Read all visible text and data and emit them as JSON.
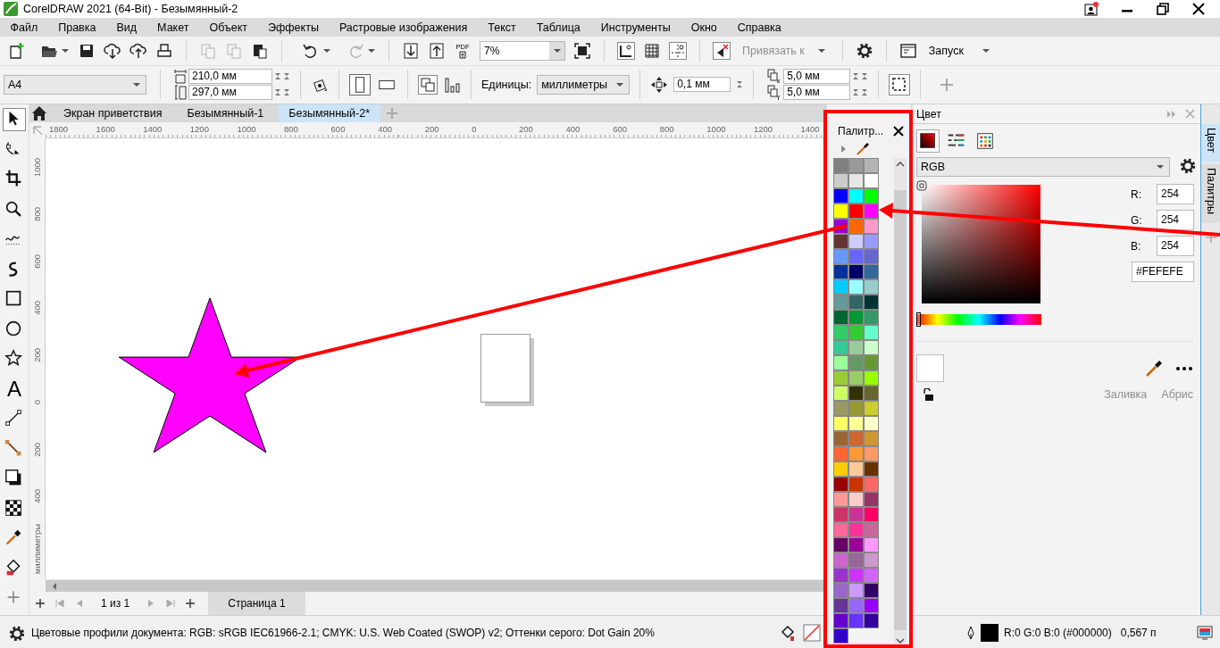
{
  "window": {
    "title": "CorelDRAW 2021 (64-Bit) - Безымянный-2"
  },
  "menu": [
    "Файл",
    "Правка",
    "Вид",
    "Макет",
    "Объект",
    "Эффекты",
    "Растровые изображения",
    "Текст",
    "Таблица",
    "Инструменты",
    "Окно",
    "Справка"
  ],
  "toolbar": {
    "buttons": [
      {
        "disabled": false
      },
      {
        "disabled": false
      },
      {
        "disabled": false
      },
      {
        "disabled": false
      },
      {
        "disabled": false
      },
      {
        "disabled": false
      },
      {
        "disabled": true
      },
      {
        "disabled": true
      },
      {
        "disabled": false
      },
      {
        "disabled": false
      },
      {
        "disabled": true
      },
      {
        "disabled": false
      },
      {
        "disabled": false
      },
      {
        "disabled": false
      },
      {
        "disabled": false
      },
      {
        "disabled": false
      },
      {
        "disabled": false
      },
      {
        "disabled": false
      },
      {
        "disabled": false
      },
      {
        "disabled": false
      },
      {
        "disabled": false
      }
    ],
    "pdf_label": "PDF",
    "zoom": "7%",
    "snap": {
      "label": "Привязать к",
      "disabled": true
    },
    "launch": "Запуск"
  },
  "property_bar": {
    "page_size": "A4",
    "width": "210,0 мм",
    "height": "297,0 мм",
    "orientation": [
      {
        "selected": true
      },
      {
        "selected": false
      }
    ],
    "units_label": "Единицы:",
    "units": "миллиметры",
    "nudge": "0,1 мм",
    "duplicate_x": "5,0 мм",
    "duplicate_y": "5,0 мм"
  },
  "toolbox": {
    "tools": [
      {
        "selected": true
      },
      {
        "selected": false
      },
      {
        "selected": false
      },
      {
        "selected": false
      },
      {
        "selected": false
      },
      {
        "selected": false
      },
      {
        "selected": false
      },
      {
        "selected": false
      },
      {
        "selected": false
      },
      {
        "selected": false,
        "glyph": "A"
      },
      {
        "selected": false
      },
      {
        "selected": false
      },
      {
        "selected": false
      },
      {
        "selected": false
      },
      {
        "selected": false
      },
      {
        "selected": false
      },
      {
        "selected": false
      }
    ]
  },
  "document_tabs": [
    {
      "label": "Экран приветствия",
      "selected": false
    },
    {
      "label": "Безымянный-1",
      "selected": false
    },
    {
      "label": "Безымянный-2*",
      "selected": true
    }
  ],
  "rulers": {
    "horizontal": [
      "1800",
      "1600",
      "1400",
      "1200",
      "1000",
      "800",
      "600",
      "400",
      "200",
      "0",
      "200",
      "400",
      "600",
      "800",
      "1000",
      "1200",
      "1400"
    ],
    "vertical": [
      "1000",
      "800",
      "600",
      "400",
      "200",
      "0",
      "200",
      "400"
    ],
    "unit": "миллиметры"
  },
  "page_nav": {
    "count": "1 из 1",
    "page_tab": "Страница 1"
  },
  "palette": {
    "title": "Палитр...",
    "swatches": [
      {
        "color": "#808080"
      },
      {
        "color": "#999999"
      },
      {
        "color": "#b3b3b3"
      },
      {
        "color": "#cccccc"
      },
      {
        "color": "#e6e6e6"
      },
      {
        "color": "#ffffff"
      },
      {
        "color": "#0000ff"
      },
      {
        "color": "#00ffff"
      },
      {
        "color": "#00ff00"
      },
      {
        "color": "#ffff00"
      },
      {
        "color": "#ff0000"
      },
      {
        "color": "#ff00ff"
      },
      {
        "color": "#9900cc"
      },
      {
        "color": "#ff6600"
      },
      {
        "color": "#ff99cc"
      },
      {
        "color": "#663333"
      },
      {
        "color": "#ccccff"
      },
      {
        "color": "#9999ff"
      },
      {
        "color": "#6699ff"
      },
      {
        "color": "#6666ff"
      },
      {
        "color": "#6666cc"
      },
      {
        "color": "#003399"
      },
      {
        "color": "#000066"
      },
      {
        "color": "#336699"
      },
      {
        "color": "#00ccff"
      },
      {
        "color": "#99ffff"
      },
      {
        "color": "#99cccc"
      },
      {
        "color": "#669999"
      },
      {
        "color": "#336666"
      },
      {
        "color": "#003333"
      },
      {
        "color": "#006633"
      },
      {
        "color": "#009933"
      },
      {
        "color": "#339966"
      },
      {
        "color": "#33cc66"
      },
      {
        "color": "#33cc33"
      },
      {
        "color": "#66ffcc"
      },
      {
        "color": "#33cc99"
      },
      {
        "color": "#99cc99"
      },
      {
        "color": "#ccffcc"
      },
      {
        "color": "#99ff99"
      },
      {
        "color": "#669966"
      },
      {
        "color": "#669933"
      },
      {
        "color": "#99cc33"
      },
      {
        "color": "#99cc66"
      },
      {
        "color": "#99ff00"
      },
      {
        "color": "#ccff66"
      },
      {
        "color": "#333300"
      },
      {
        "color": "#666633"
      },
      {
        "color": "#999966"
      },
      {
        "color": "#999933"
      },
      {
        "color": "#cccc33"
      },
      {
        "color": "#ffff66"
      },
      {
        "color": "#ffff99"
      },
      {
        "color": "#ffffcc"
      },
      {
        "color": "#996633"
      },
      {
        "color": "#cc6633"
      },
      {
        "color": "#cc9933"
      },
      {
        "color": "#ff6633"
      },
      {
        "color": "#ff9933"
      },
      {
        "color": "#ff9966"
      },
      {
        "color": "#ffcc00"
      },
      {
        "color": "#ffcc99"
      },
      {
        "color": "#663300"
      },
      {
        "color": "#990000"
      },
      {
        "color": "#cc3300"
      },
      {
        "color": "#ff6666"
      },
      {
        "color": "#ff9999"
      },
      {
        "color": "#ffcccc"
      },
      {
        "color": "#993366"
      },
      {
        "color": "#cc3366"
      },
      {
        "color": "#cc3399"
      },
      {
        "color": "#ff0066"
      },
      {
        "color": "#ff6699"
      },
      {
        "color": "#ff3399"
      },
      {
        "color": "#cc6699"
      },
      {
        "color": "#660066"
      },
      {
        "color": "#990099"
      },
      {
        "color": "#ff99ff"
      },
      {
        "color": "#cc66cc"
      },
      {
        "color": "#996699"
      },
      {
        "color": "#cc99cc"
      },
      {
        "color": "#9933cc"
      },
      {
        "color": "#cc33ff"
      },
      {
        "color": "#cc66ff"
      },
      {
        "color": "#9966cc"
      },
      {
        "color": "#cc99ff"
      },
      {
        "color": "#330066"
      },
      {
        "color": "#663399"
      },
      {
        "color": "#9966ff"
      },
      {
        "color": "#9900ff"
      },
      {
        "color": "#6600cc"
      },
      {
        "color": "#6633ff"
      },
      {
        "color": "#330099"
      },
      {
        "color": "#3300cc"
      }
    ]
  },
  "color_docker": {
    "title": "Цвет",
    "view_modes": [
      {
        "selected": true
      },
      {
        "selected": false
      },
      {
        "selected": false
      }
    ],
    "model": "RGB",
    "r_label": "R:",
    "r": "254",
    "g_label": "G:",
    "g": "254",
    "b_label": "B:",
    "b": "254",
    "hex": "#FEFEFE",
    "hue": {
      "level": 0
    },
    "fill": {
      "label": "Заливка",
      "disabled": true
    },
    "outline": {
      "label": "Абрис",
      "disabled": true
    }
  },
  "docker_tabs": [
    {
      "label": "Цвет",
      "selected": true
    },
    {
      "label": "Палитры",
      "selected": false
    }
  ],
  "status_bar": {
    "profiles": "Цветовые профили документа: RGB: sRGB IEC61966-2.1; CMYK: U.S. Web Coated (SWOP) v2; Оттенки серого: Dot Gain 20%",
    "outline_color": "R:0 G:0 B:0 (#000000)",
    "outline_width": "0,567 п"
  }
}
